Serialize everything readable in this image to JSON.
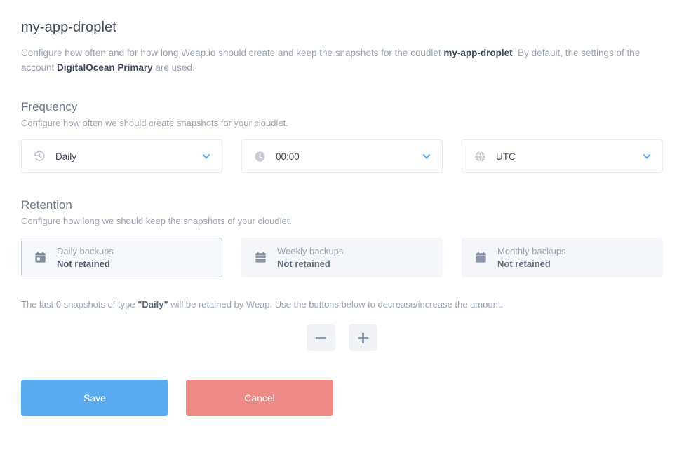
{
  "header": {
    "title": "my-app-droplet",
    "intro_part1": "Configure how often and for how long Weap.io should create and keep the snapshots for the coudlet ",
    "intro_strong1": "my-app-droplet",
    "intro_part2": ". By default, the settings of the account ",
    "intro_strong2": "DigitalOcean Primary",
    "intro_part3": " are used."
  },
  "frequency": {
    "title": "Frequency",
    "subtitle": "Configure how often we should create snapshots for your cloudlet.",
    "fields": [
      {
        "icon": "history-icon",
        "value": "Daily",
        "name": "frequency-select"
      },
      {
        "icon": "clock-icon",
        "value": "00:00",
        "name": "time-select"
      },
      {
        "icon": "globe-icon",
        "value": "UTC",
        "name": "timezone-select"
      }
    ]
  },
  "retention": {
    "title": "Retention",
    "subtitle": "Configure how long we should keep the snapshots of your cloudlet.",
    "cards": [
      {
        "label": "Daily backups",
        "status": "Not retained",
        "selected": true,
        "name": "retention-card-daily"
      },
      {
        "label": "Weekly backups",
        "status": "Not retained",
        "selected": false,
        "name": "retention-card-weekly"
      },
      {
        "label": "Monthly backups",
        "status": "Not retained",
        "selected": false,
        "name": "retention-card-monthly"
      }
    ],
    "note_part1": "The last 0 snapshots of type ",
    "note_strong": "\"Daily\"",
    "note_part2": " will be retained by Weap. Use the buttons below to decrease/increase the amount.",
    "decrease_label": "−",
    "increase_label": "+"
  },
  "actions": {
    "save_label": "Save",
    "cancel_label": "Cancel"
  },
  "colors": {
    "accent": "#5aabf0",
    "danger": "#ee8a85",
    "heading": "#3d4759",
    "muted": "#9aa3b0",
    "card_bg": "#f5f6f9",
    "selected_border": "#c9d4e2"
  }
}
